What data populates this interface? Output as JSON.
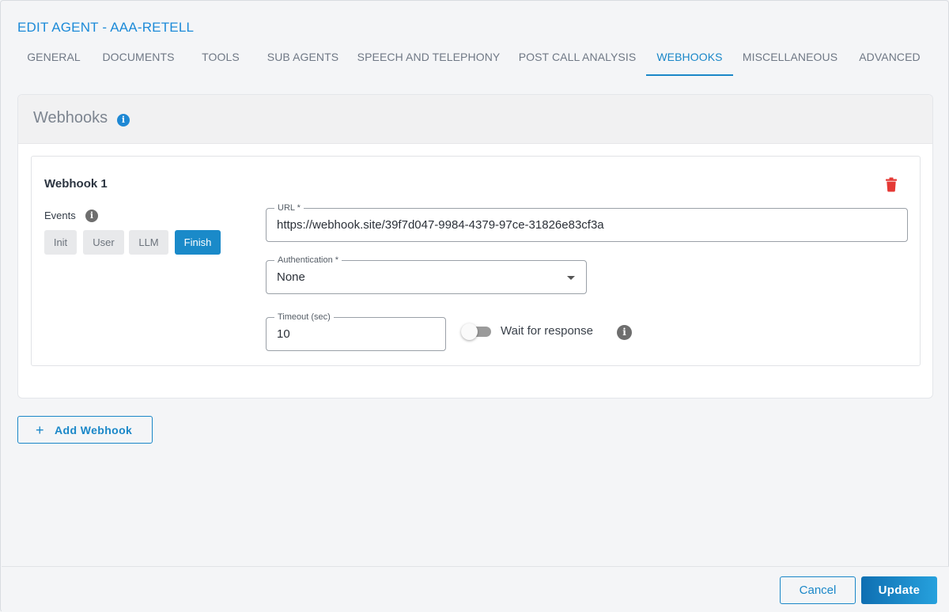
{
  "page_title": "EDIT AGENT - AAA-RETELL",
  "tabs": [
    {
      "label": "GENERAL"
    },
    {
      "label": "DOCUMENTS"
    },
    {
      "label": "TOOLS"
    },
    {
      "label": "SUB AGENTS"
    },
    {
      "label": "SPEECH AND TELEPHONY"
    },
    {
      "label": "POST CALL ANALYSIS"
    },
    {
      "label": "WEBHOOKS"
    },
    {
      "label": "MISCELLANEOUS"
    },
    {
      "label": "ADVANCED"
    }
  ],
  "active_tab": "WEBHOOKS",
  "section": {
    "title": "Webhooks",
    "info_icon": "info-icon"
  },
  "webhooks": [
    {
      "title": "Webhook 1",
      "events_label": "Events",
      "events": [
        {
          "label": "Init",
          "selected": false
        },
        {
          "label": "User",
          "selected": false
        },
        {
          "label": "LLM",
          "selected": false
        },
        {
          "label": "Finish",
          "selected": true
        }
      ],
      "url": {
        "label": "URL *",
        "value": "https://webhook.site/39f7d047-9984-4379-97ce-31826e83cf3a"
      },
      "authentication": {
        "label": "Authentication *",
        "value": "None"
      },
      "timeout": {
        "label": "Timeout (sec)",
        "value": "10"
      },
      "wait_for_response": {
        "label": "Wait for response",
        "enabled": false
      }
    }
  ],
  "add_webhook_label": "Add Webhook",
  "footer": {
    "cancel_label": "Cancel",
    "update_label": "Update"
  },
  "colors": {
    "accent": "#1a87c8",
    "delete": "#e53935",
    "active_event": "#1a8ac9"
  }
}
